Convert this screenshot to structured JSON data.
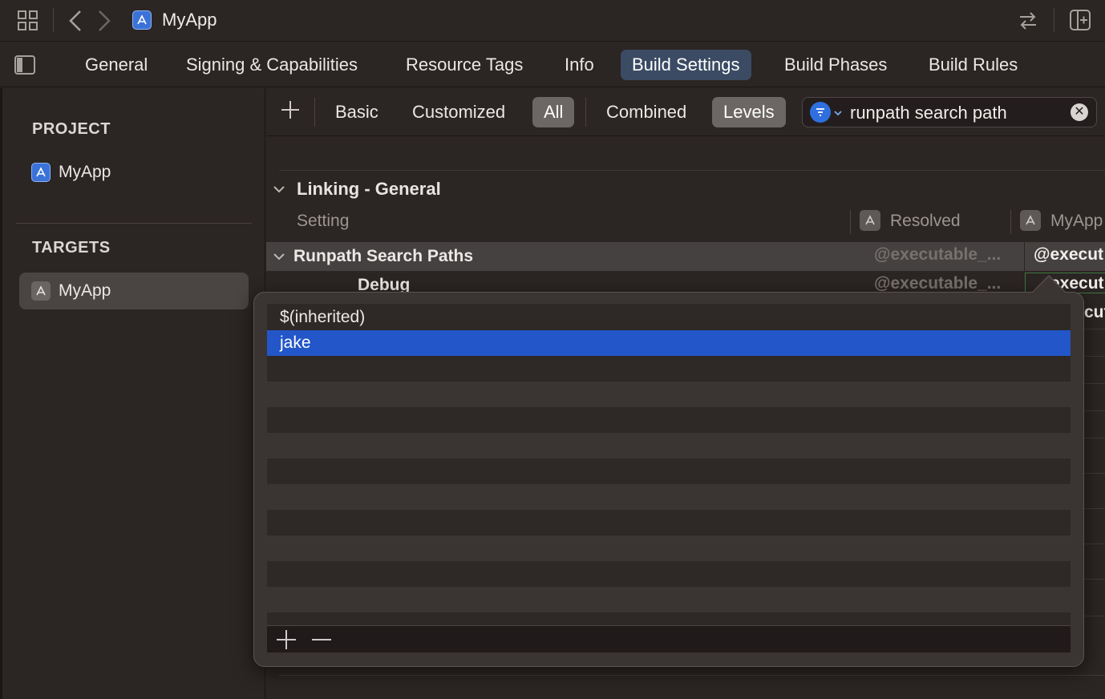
{
  "titlebar": {
    "app_name": "MyApp",
    "icons": [
      "grid-icon",
      "back-icon",
      "forward-icon",
      "app-icon",
      "swap-icon",
      "add-editor-icon"
    ]
  },
  "tabs": [
    {
      "label": "General",
      "active": false
    },
    {
      "label": "Signing & Capabilities",
      "active": false
    },
    {
      "label": "Resource Tags",
      "active": false
    },
    {
      "label": "Info",
      "active": false
    },
    {
      "label": "Build Settings",
      "active": true
    },
    {
      "label": "Build Phases",
      "active": false
    },
    {
      "label": "Build Rules",
      "active": false
    }
  ],
  "sidebar": {
    "project_header": "PROJECT",
    "project_item": "MyApp",
    "targets_header": "TARGETS",
    "target_item": "MyApp"
  },
  "filterbar": {
    "basic": "Basic",
    "customized": "Customized",
    "all": "All",
    "combined": "Combined",
    "levels": "Levels",
    "search_value": "runpath search path"
  },
  "settings": {
    "section_title": "Linking - General",
    "col_setting": "Setting",
    "col_resolved": "Resolved",
    "col_target": "MyApp",
    "row_name": "Runpath Search Paths",
    "row_resolved": "@executable_...",
    "row_value": "@execut",
    "sub_row_name": "Debug",
    "sub_row_resolved": "@executable_...",
    "sub_row_value": "execut",
    "sub_row2_value": "cut"
  },
  "popover": {
    "items": [
      "$(inherited)",
      "jake"
    ],
    "selected_index": 1,
    "add_label": "+",
    "remove_label": "—"
  },
  "colors": {
    "accent": "#2356c8",
    "active_tab": "#3b4b63",
    "background": "#2b2523"
  }
}
